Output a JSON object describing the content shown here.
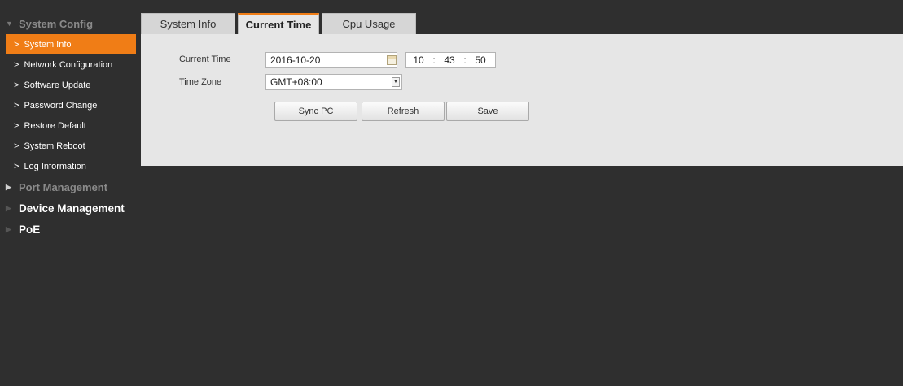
{
  "sidebar": {
    "system_config": "System Config",
    "items": [
      {
        "label": "System Info"
      },
      {
        "label": "Network Configuration"
      },
      {
        "label": "Software Update"
      },
      {
        "label": "Password Change"
      },
      {
        "label": "Restore Default"
      },
      {
        "label": "System Reboot"
      },
      {
        "label": "Log Information"
      }
    ],
    "port_management": "Port Management",
    "device_management": "Device Management",
    "poe": "PoE"
  },
  "tabs": [
    {
      "label": "System Info"
    },
    {
      "label": "Current Time"
    },
    {
      "label": "Cpu Usage"
    }
  ],
  "form": {
    "current_time_label": "Current Time",
    "date_value": "2016-10-20",
    "hour": "10",
    "minute": "43",
    "second": "50",
    "time_sep": ":",
    "time_zone_label": "Time Zone",
    "time_zone_value": "GMT+08:00"
  },
  "buttons": {
    "sync_pc": "Sync PC",
    "refresh": "Refresh",
    "save": "Save"
  },
  "colors": {
    "accent": "#f07d16",
    "background": "#2f2f2f",
    "panel": "#e6e6e6"
  }
}
